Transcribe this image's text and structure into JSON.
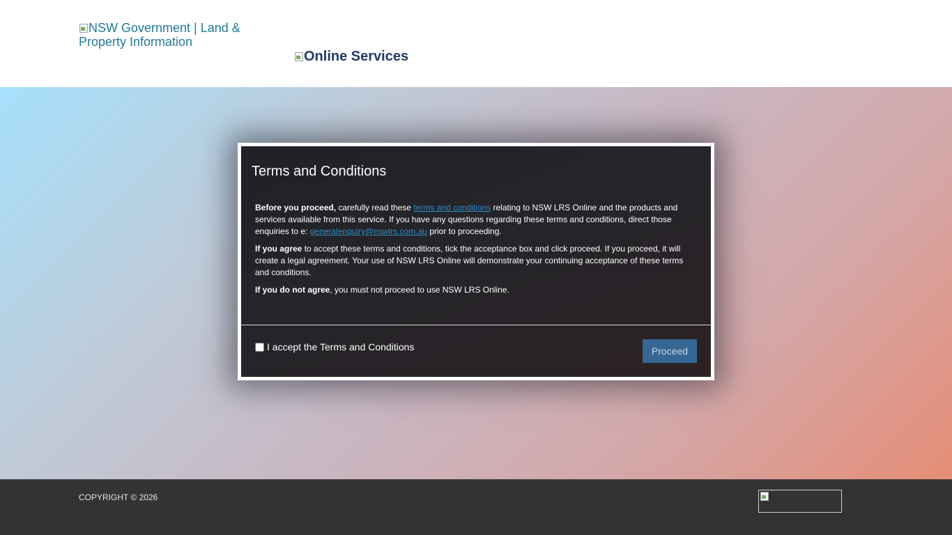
{
  "header": {
    "logo_alt": "NSW Government | Land & Property Information",
    "services_alt": "Online Services"
  },
  "modal": {
    "title": "Terms and Conditions",
    "p1": {
      "bold": "Before you proceed,",
      "text1": " carefully read these ",
      "link": "terms and conditions",
      "text2": " relating to NSW LRS Online and the products and services available from this service. If you have any questions regarding these terms and conditions, direct those enquiries to e: ",
      "email": "generalenquiry@nswlrs.com.au",
      "text3": " prior to proceeding."
    },
    "p2": {
      "bold": "If you agree",
      "text": " to accept these terms and conditions, tick the acceptance box and click proceed. If you proceed, it will create a legal agreement. Your use of NSW LRS Online will demonstrate your continuing acceptance of these terms and conditions."
    },
    "p3": {
      "bold": "If you do not agree",
      "text": ", you must not proceed to use NSW LRS Online."
    },
    "accept_label": "I accept the Terms and Conditions",
    "accept_checked": false,
    "proceed_label": "Proceed"
  },
  "footer": {
    "copyright": "COPYRIGHT © 2026"
  },
  "colors": {
    "link": "#2f8fc6",
    "proceed_button": "#356694",
    "footer_bg": "#333333",
    "header_logo_text": "#1f7a99",
    "services_text": "#1d3c66"
  }
}
